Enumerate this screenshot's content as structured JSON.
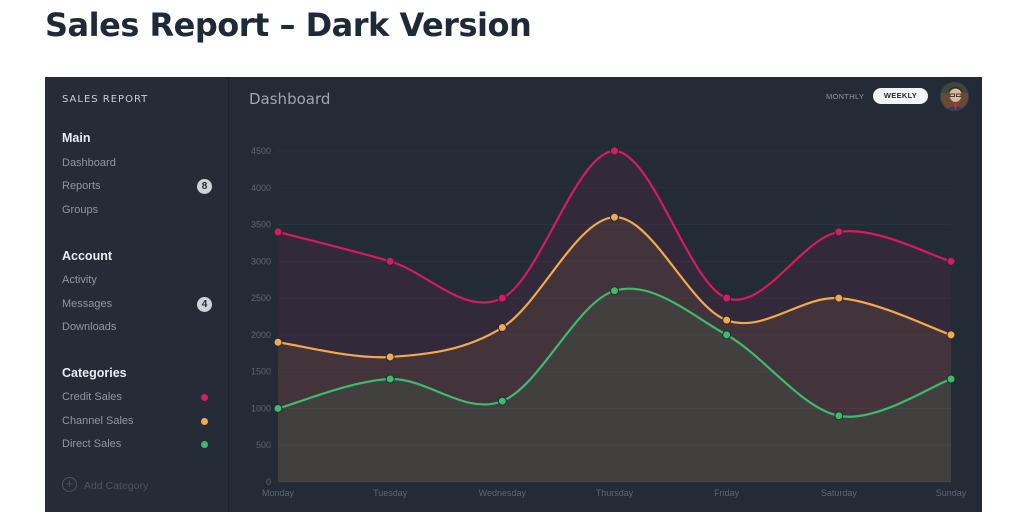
{
  "page": {
    "heading": "Sales Report – Dark Version"
  },
  "sidebar": {
    "brand": "SALES REPORT",
    "sections": {
      "main": {
        "title": "Main",
        "items": [
          {
            "label": "Dashboard"
          },
          {
            "label": "Reports",
            "badge": "8"
          },
          {
            "label": "Groups"
          }
        ]
      },
      "account": {
        "title": "Account",
        "items": [
          {
            "label": "Activity"
          },
          {
            "label": "Messages",
            "badge": "4"
          },
          {
            "label": "Downloads"
          }
        ]
      },
      "categories": {
        "title": "Categories",
        "items": [
          {
            "label": "Credit Sales",
            "color": "#d81b60"
          },
          {
            "label": "Channel Sales",
            "color": "#f5a84c"
          },
          {
            "label": "Direct Sales",
            "color": "#3dbb6c"
          }
        ]
      }
    },
    "add_category": {
      "label": "Add Category",
      "icon": "plus-circle-icon"
    }
  },
  "header": {
    "title": "Dashboard",
    "period": {
      "options": [
        "MONTHLY",
        "WEEKLY"
      ],
      "selected": "WEEKLY"
    },
    "avatar_icon": "user-avatar-icon"
  },
  "chart_data": {
    "type": "area",
    "categories": [
      "Monday",
      "Tuesday",
      "Wednesday",
      "Thursday",
      "Friday",
      "Saturday",
      "Sunday"
    ],
    "ylim": [
      0,
      4500
    ],
    "yticks": [
      0,
      500,
      1000,
      1500,
      2000,
      2500,
      3000,
      3500,
      4000,
      4500
    ],
    "grid": true,
    "series": [
      {
        "name": "Credit Sales",
        "color": "#d81b60",
        "values": [
          3400,
          3000,
          2500,
          4500,
          2500,
          3400,
          3000
        ]
      },
      {
        "name": "Channel Sales",
        "color": "#f5a84c",
        "values": [
          1900,
          1700,
          2100,
          3600,
          2200,
          2500,
          2000
        ]
      },
      {
        "name": "Direct Sales",
        "color": "#3dbb6c",
        "values": [
          1000,
          1400,
          1100,
          2600,
          2000,
          900,
          1400
        ]
      }
    ]
  }
}
